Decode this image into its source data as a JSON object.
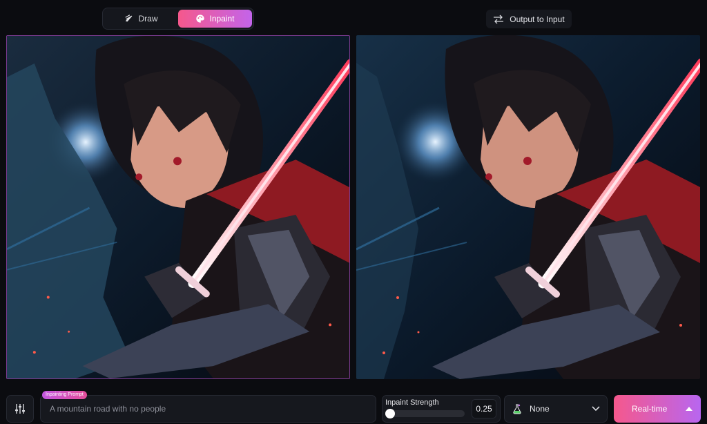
{
  "mode_toggle": {
    "draw_label": "Draw",
    "inpaint_label": "Inpaint",
    "active": "Inpaint"
  },
  "output_button": {
    "label": "Output to Input"
  },
  "prompt": {
    "tag": "Inpainting Prompt",
    "placeholder": "A mountain road with no people"
  },
  "strength": {
    "label": "Inpaint Strength",
    "value": "0.25"
  },
  "style_select": {
    "selected": "None"
  },
  "realtime_button": {
    "label": "Real-time"
  },
  "colors": {
    "accent_pink": "#f5588c",
    "accent_purple": "#c364ea",
    "background": "#0b0c10",
    "saber_red": "#ff3a5a"
  },
  "icons": {
    "draw": "brush-icon",
    "inpaint": "palette-icon",
    "output": "swap-arrows-icon",
    "settings": "sliders-icon",
    "style": "flask-icon",
    "dropdown": "chevron-down-icon",
    "realtime": "caret-up-icon"
  }
}
